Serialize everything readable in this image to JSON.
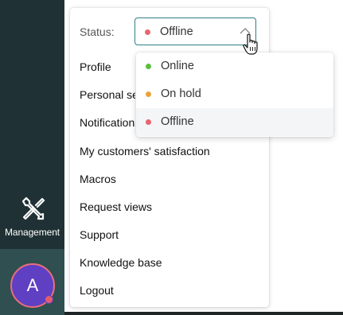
{
  "sidebar": {
    "management_label": "Management",
    "avatar_initial": "A",
    "background": "#1f3134",
    "avatar_color": "#5f3fc2"
  },
  "menu": {
    "status_label": "Status:",
    "status_value": "Offline",
    "items": [
      "Profile",
      "Personal settings",
      "Notifications",
      "My customers' satisfaction",
      "Macros",
      "Request views",
      "Support",
      "Knowledge base",
      "Logout"
    ]
  },
  "status_options": [
    {
      "label": "Online",
      "color": "#5bbf3d"
    },
    {
      "label": "On hold",
      "color": "#e8a33a"
    },
    {
      "label": "Offline",
      "color": "#e8666f",
      "selected": true
    }
  ],
  "accent_color": "#2d7f87"
}
